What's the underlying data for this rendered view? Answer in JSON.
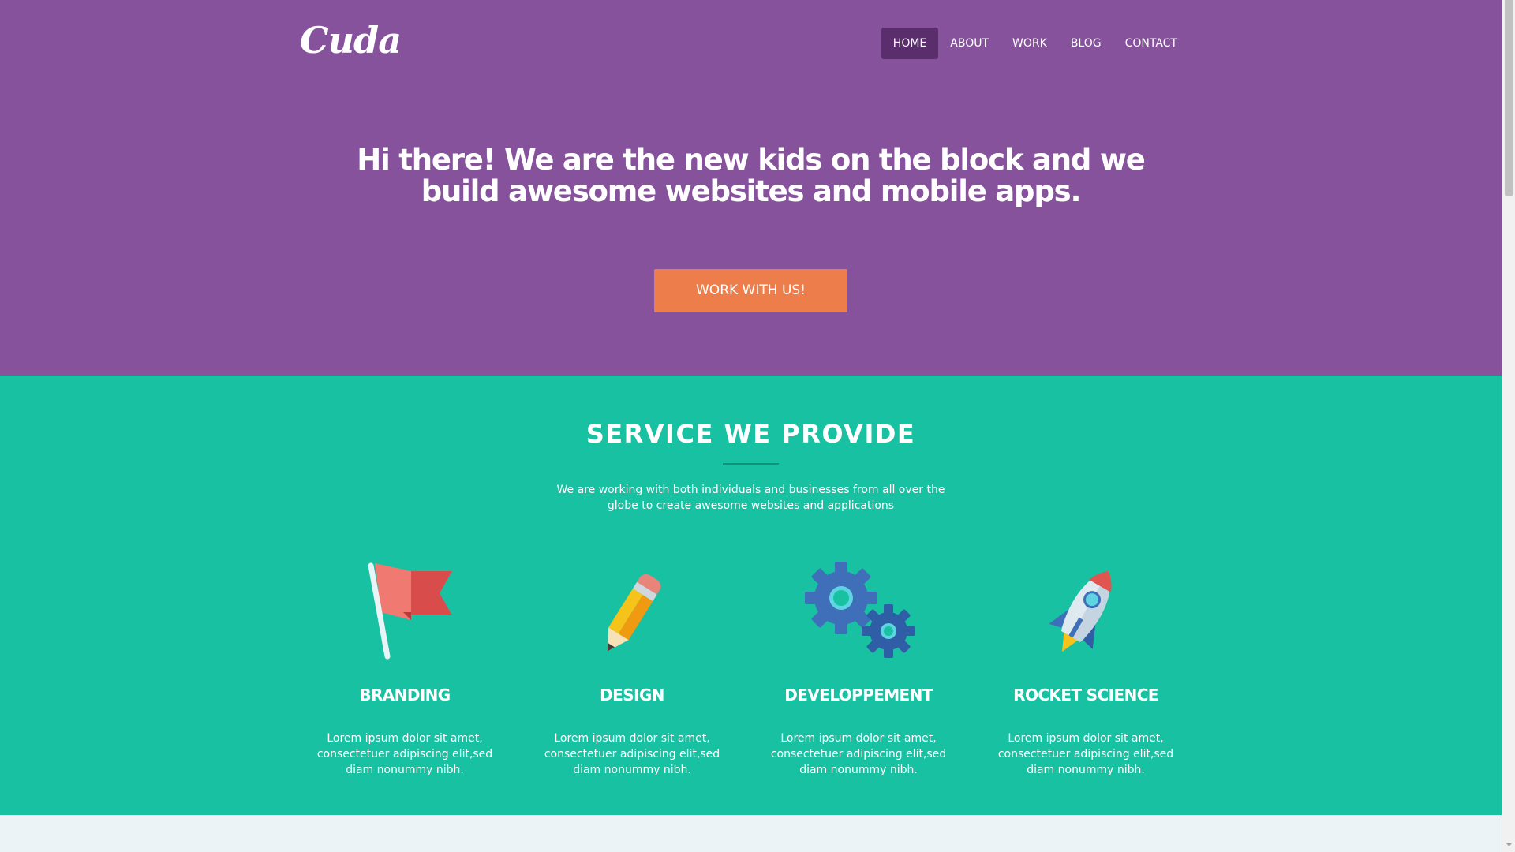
{
  "brand": {
    "logo": "Cuda"
  },
  "nav": {
    "items": [
      {
        "label": "HOME",
        "active": true
      },
      {
        "label": "ABOUT",
        "active": false
      },
      {
        "label": "WORK",
        "active": false
      },
      {
        "label": "BLOG",
        "active": false
      },
      {
        "label": "CONTACT",
        "active": false
      }
    ]
  },
  "hero": {
    "title": "Hi there! We are the new kids on the block and we build awesome websites and mobile apps.",
    "cta_label": "WORK WITH US!"
  },
  "services": {
    "title": "SERVICE WE PROVIDE",
    "lead": "We are working with both individuals and businesses from all over the globe to create awesome websites and applications",
    "items": [
      {
        "title": "BRANDING",
        "icon": "flag-icon",
        "text": "Lorem ipsum dolor sit amet, consectetuer adipiscing elit,sed diam nonummy nibh."
      },
      {
        "title": "DESIGN",
        "icon": "pencil-icon",
        "text": "Lorem ipsum dolor sit amet, consectetuer adipiscing elit,sed diam nonummy nibh."
      },
      {
        "title": "DEVELOPPEMENT",
        "icon": "gears-icon",
        "text": "Lorem ipsum dolor sit amet, consectetuer adipiscing elit,sed diam nonummy nibh."
      },
      {
        "title": "ROCKET SCIENCE",
        "icon": "rocket-icon",
        "text": "Lorem ipsum dolor sit amet, consectetuer adipiscing elit,sed diam nonummy nibh."
      }
    ]
  },
  "colors": {
    "hero_bg": "#86529c",
    "nav_active_bg": "#5a2d6d",
    "cta_bg": "#ed7d4b",
    "services_bg": "#18c1a2",
    "rule": "#11907a",
    "below_bg": "#ecf3f6"
  }
}
